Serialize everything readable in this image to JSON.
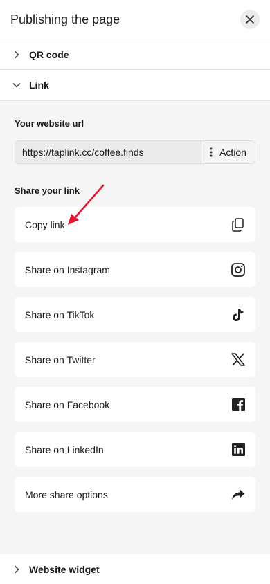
{
  "header": {
    "title": "Publishing the page"
  },
  "sections": {
    "qr": "QR code",
    "link": "Link",
    "widget": "Website widget"
  },
  "link_panel": {
    "url_label": "Your website url",
    "url_value": "https://taplink.cc/coffee.finds",
    "action_label": "Action",
    "share_label": "Share your link",
    "share_items": [
      {
        "label": "Copy link",
        "icon": "copy-icon"
      },
      {
        "label": "Share on Instagram",
        "icon": "instagram-icon"
      },
      {
        "label": "Share on TikTok",
        "icon": "tiktok-icon"
      },
      {
        "label": "Share on Twitter",
        "icon": "x-twitter-icon"
      },
      {
        "label": "Share on Facebook",
        "icon": "facebook-icon"
      },
      {
        "label": "Share on LinkedIn",
        "icon": "linkedin-icon"
      },
      {
        "label": "More share options",
        "icon": "share-arrow-icon"
      }
    ]
  },
  "colors": {
    "panel_bg": "#f5f5f5",
    "annotation_arrow": "#e8132f"
  }
}
